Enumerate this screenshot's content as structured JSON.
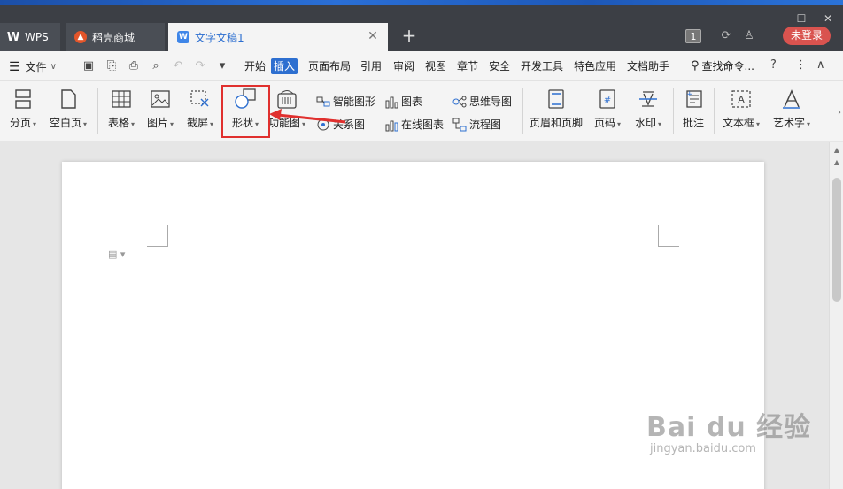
{
  "tabs": {
    "wps": "WPS",
    "store": "稻壳商城",
    "doc": "文字文稿1"
  },
  "titlebar": {
    "badge": "1",
    "login": "未登录"
  },
  "menu": {
    "file": "文件",
    "tabs": [
      "开始",
      "插入",
      "页面布局",
      "引用",
      "审阅",
      "视图",
      "章节",
      "安全",
      "开发工具",
      "特色应用",
      "文档助手"
    ],
    "active_tab": "插入",
    "search": "查找命令..."
  },
  "ribbon": {
    "fenye": "分页",
    "kongbaiye": "空白页",
    "biaoge": "表格",
    "tupian": "图片",
    "jieping": "截屏",
    "xingzhuang": "形状",
    "gongnengtu": "功能图",
    "zhinengtuxing": "智能图形",
    "tubiao": "图表",
    "siweidaotu": "思维导图",
    "guanxitu": "关系图",
    "zaixiantubiao": "在线图表",
    "liuchengtu": "流程图",
    "yemeiheyejiao": "页眉和页脚",
    "yema": "页码",
    "shuiyin": "水印",
    "pizhu": "批注",
    "wenbenkuang": "文本框",
    "yishuzi": "艺术字"
  },
  "watermark": {
    "main": "Bai du 经验",
    "sub": "jingyan.baidu.com"
  },
  "colors": {
    "accent": "#2d6fd0",
    "highlight": "#e0302e",
    "login": "#d9534f"
  }
}
